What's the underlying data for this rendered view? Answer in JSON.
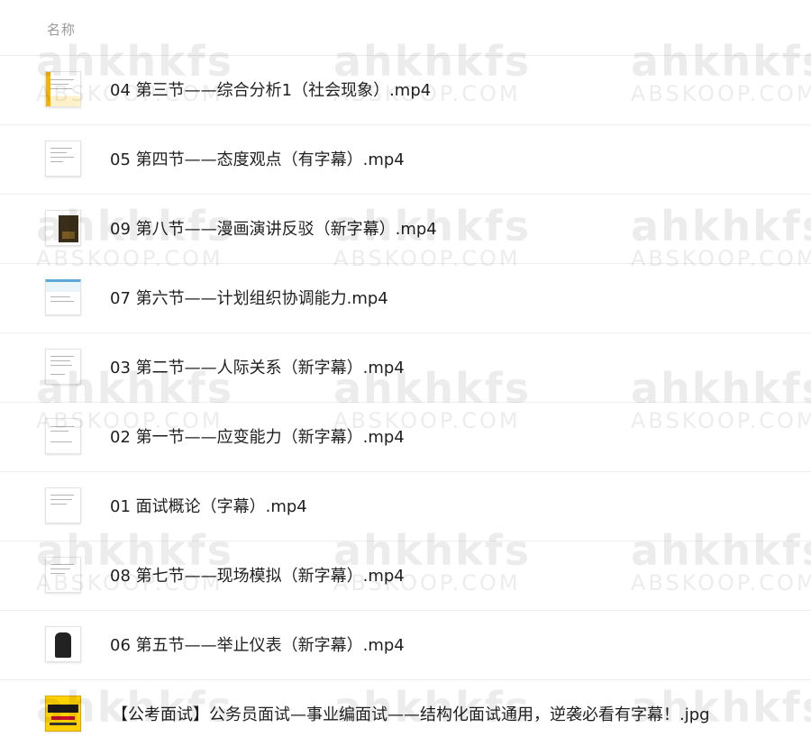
{
  "header": {
    "name_column": "名称"
  },
  "files": [
    {
      "name": "04 第三节——综合分析1（社会现象）.mp4",
      "thumb": "doc-yellow",
      "thumb_icon": "video-thumbnail-icon"
    },
    {
      "name": "05 第四节——态度观点（有字幕）.mp4",
      "thumb": "doc",
      "thumb_icon": "video-thumbnail-icon"
    },
    {
      "name": "09 第八节——漫画演讲反驳（新字幕）.mp4",
      "thumb": "dark",
      "thumb_icon": "video-thumbnail-icon"
    },
    {
      "name": "07 第六节——计划组织协调能力.mp4",
      "thumb": "blue",
      "thumb_icon": "video-thumbnail-icon"
    },
    {
      "name": "03 第二节——人际关系（新字幕）.mp4",
      "thumb": "doc",
      "thumb_icon": "video-thumbnail-icon"
    },
    {
      "name": "02 第一节——应变能力（新字幕）.mp4",
      "thumb": "doc",
      "thumb_icon": "video-thumbnail-icon"
    },
    {
      "name": "01 面试概论（字幕）.mp4",
      "thumb": "doc",
      "thumb_icon": "video-thumbnail-icon"
    },
    {
      "name": "08 第七节——现场模拟（新字幕）.mp4",
      "thumb": "doc",
      "thumb_icon": "video-thumbnail-icon"
    },
    {
      "name": "06 第五节——举止仪表（新字幕）.mp4",
      "thumb": "person",
      "thumb_icon": "video-thumbnail-icon"
    },
    {
      "name": "【公考面试】公务员面试—事业编面试——结构化面试通用，逆袭必看有字幕！.jpg",
      "thumb": "jpg",
      "thumb_icon": "image-thumbnail-icon"
    }
  ],
  "watermark": {
    "logo": "ahkhkfs",
    "site": "ABSKOOP.COM"
  },
  "colors": {
    "header_text": "#9a9a9a",
    "row_divider": "#eeeeee",
    "file_text": "#1f1f1f"
  }
}
